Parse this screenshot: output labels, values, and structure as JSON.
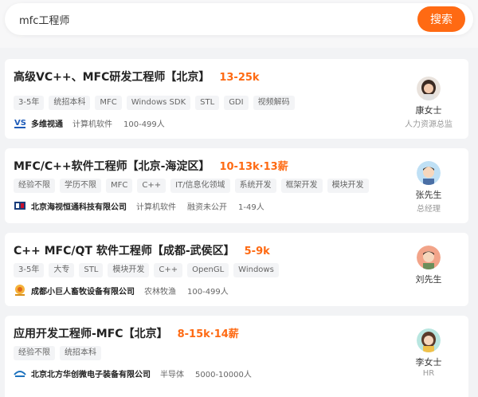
{
  "search": {
    "query": "mfc工程师",
    "button_label": "搜索"
  },
  "jobs": [
    {
      "title": "高级VC++、MFC研发工程师【北京】",
      "salary": "13-25k",
      "tags": [
        "3-5年",
        "统招本科",
        "MFC",
        "Windows SDK",
        "STL",
        "GDI",
        "视频解码"
      ],
      "company": "多维视通",
      "industry": "计算机软件",
      "extra": "",
      "size": "100-499人",
      "logo_icon": "company-logo-vs-icon",
      "recruiter": {
        "name": "康女士",
        "role": "人力资源总监",
        "avatar_icon": "avatar-woman-icon"
      }
    },
    {
      "title": "MFC/C++软件工程师【北京-海淀区】",
      "salary": "10-13k·13薪",
      "tags": [
        "经验不限",
        "学历不限",
        "MFC",
        "C++",
        "IT/信息化领域",
        "系统开发",
        "框架开发",
        "模块开发"
      ],
      "company": "北京海视恒通科技有限公司",
      "industry": "计算机软件",
      "extra": "融资未公开",
      "size": "1-49人",
      "logo_icon": "company-logo-hs-icon",
      "recruiter": {
        "name": "张先生",
        "role": "总经理",
        "avatar_icon": "avatar-man-icon"
      }
    },
    {
      "title": "C++ MFC/QT 软件工程师【成都-武侯区】",
      "salary": "5-9k",
      "tags": [
        "3-5年",
        "大专",
        "STL",
        "模块开发",
        "C++",
        "OpenGL",
        "Windows"
      ],
      "company": "成都小巨人畜牧设备有限公司",
      "industry": "农林牧渔",
      "extra": "",
      "size": "100-499人",
      "logo_icon": "company-logo-xjr-icon",
      "recruiter": {
        "name": "刘先生",
        "role": "",
        "avatar_icon": "avatar-man-icon"
      }
    },
    {
      "title": "应用开发工程师-MFC【北京】",
      "salary": "8-15k·14薪",
      "tags": [
        "经验不限",
        "统招本科"
      ],
      "company": "北京北方华创微电子装备有限公司",
      "industry": "半导体",
      "extra": "",
      "size": "5000-10000人",
      "logo_icon": "company-logo-naura-icon",
      "recruiter": {
        "name": "李女士",
        "role": "HR",
        "avatar_icon": "avatar-woman-icon"
      }
    }
  ],
  "colors": {
    "accent": "#ff6a13",
    "salary": "#fe6a13",
    "tag_bg": "#f3f4f6",
    "page_bg": "#f2f3f5"
  }
}
